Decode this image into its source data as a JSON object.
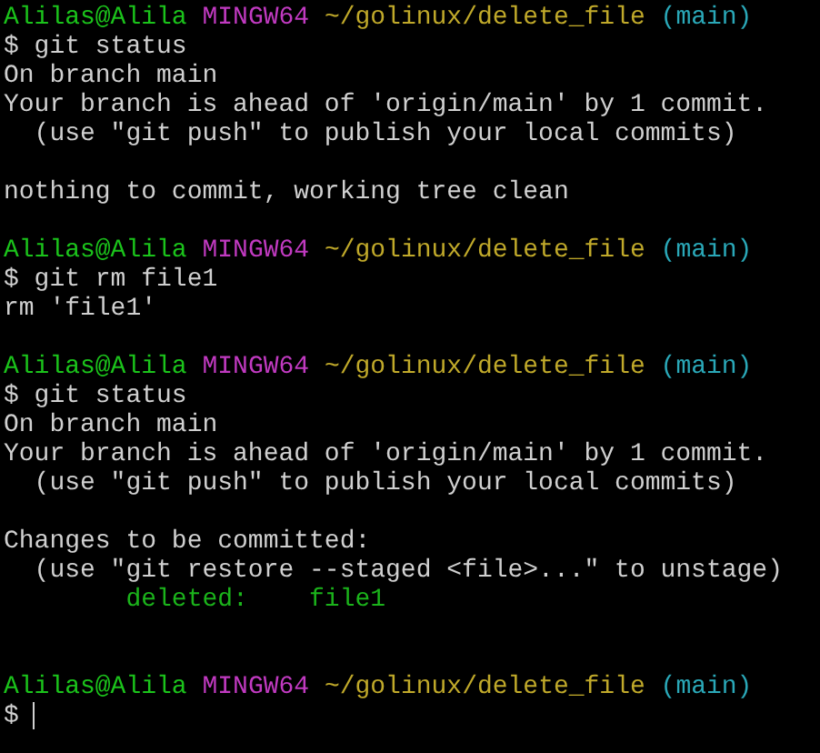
{
  "lines": [
    {
      "kind": "prompt",
      "user": "Alilas@Alila",
      "shell": "MINGW64",
      "path": "~/golinux/delete_file",
      "branch": "(main)"
    },
    {
      "kind": "command",
      "text": "$ git status"
    },
    {
      "kind": "output",
      "text": "On branch main"
    },
    {
      "kind": "output",
      "text": "Your branch is ahead of 'origin/main' by 1 commit."
    },
    {
      "kind": "output",
      "text": "  (use \"git push\" to publish your local commits)"
    },
    {
      "kind": "blank"
    },
    {
      "kind": "output",
      "text": "nothing to commit, working tree clean"
    },
    {
      "kind": "blank"
    },
    {
      "kind": "prompt",
      "user": "Alilas@Alila",
      "shell": "MINGW64",
      "path": "~/golinux/delete_file",
      "branch": "(main)"
    },
    {
      "kind": "command",
      "text": "$ git rm file1"
    },
    {
      "kind": "output",
      "text": "rm 'file1'"
    },
    {
      "kind": "blank"
    },
    {
      "kind": "prompt",
      "user": "Alilas@Alila",
      "shell": "MINGW64",
      "path": "~/golinux/delete_file",
      "branch": "(main)"
    },
    {
      "kind": "command",
      "text": "$ git status"
    },
    {
      "kind": "output",
      "text": "On branch main"
    },
    {
      "kind": "output",
      "text": "Your branch is ahead of 'origin/main' by 1 commit."
    },
    {
      "kind": "output",
      "text": "  (use \"git push\" to publish your local commits)"
    },
    {
      "kind": "blank"
    },
    {
      "kind": "output",
      "text": "Changes to be committed:"
    },
    {
      "kind": "output",
      "text": "  (use \"git restore --staged <file>...\" to unstage)"
    },
    {
      "kind": "staged",
      "text": "        deleted:    file1"
    },
    {
      "kind": "blank"
    },
    {
      "kind": "blank"
    },
    {
      "kind": "prompt",
      "user": "Alilas@Alila",
      "shell": "MINGW64",
      "path": "~/golinux/delete_file",
      "branch": "(main)"
    },
    {
      "kind": "input",
      "text": "$"
    }
  ]
}
